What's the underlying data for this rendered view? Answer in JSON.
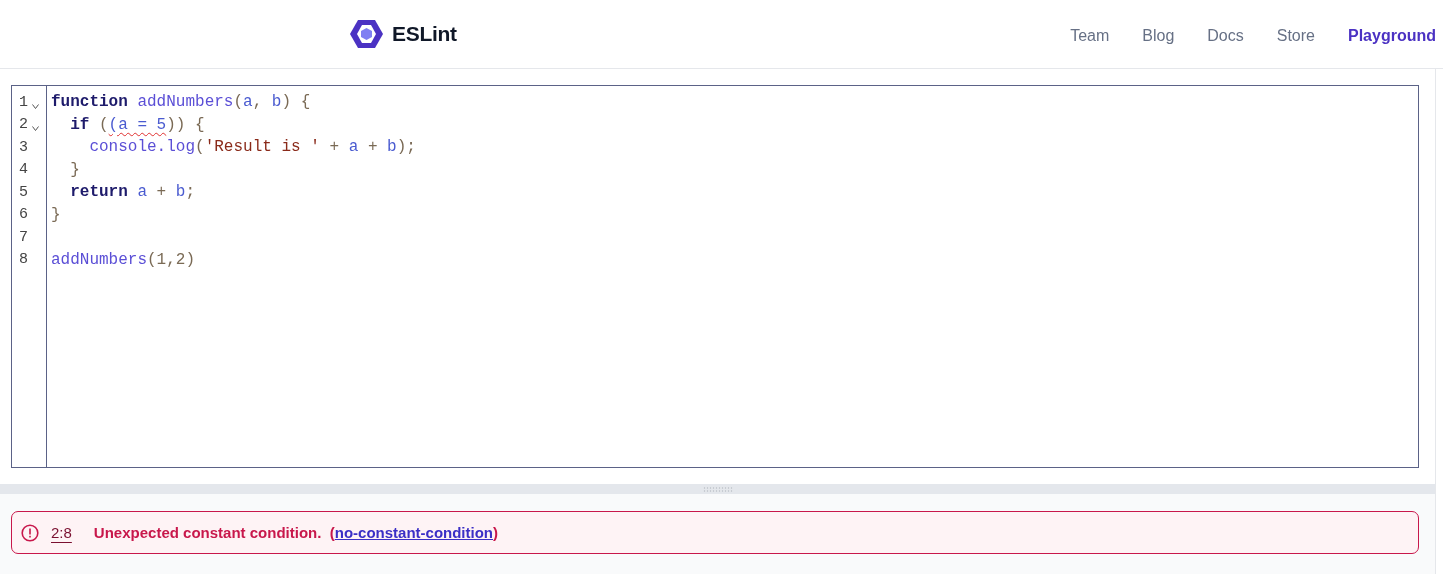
{
  "header": {
    "logo_text": "ESLint",
    "nav": [
      {
        "label": "Team",
        "selected": false
      },
      {
        "label": "Blog",
        "selected": false
      },
      {
        "label": "Docs",
        "selected": false
      },
      {
        "label": "Store",
        "selected": false
      },
      {
        "label": "Playground",
        "selected": true
      }
    ]
  },
  "editor": {
    "lines": [
      {
        "number": "1",
        "foldable": true,
        "tokens": [
          {
            "text": "function",
            "kind": "keyword"
          },
          {
            "text": " addNumbers",
            "kind": "name"
          },
          {
            "text": "(",
            "kind": "punct"
          },
          {
            "text": "a",
            "kind": "var"
          },
          {
            "text": ", ",
            "kind": "punct"
          },
          {
            "text": "b",
            "kind": "var"
          },
          {
            "text": ") {",
            "kind": "punct"
          }
        ]
      },
      {
        "number": "2",
        "foldable": true,
        "tokens": [
          {
            "text": "  if",
            "kind": "keyword"
          },
          {
            "text": " (",
            "kind": "punct"
          },
          {
            "text": "(a = 5",
            "kind": "var",
            "error": true
          },
          {
            "text": ")) {",
            "kind": "punct"
          }
        ]
      },
      {
        "number": "3",
        "foldable": false,
        "tokens": [
          {
            "text": "    console.log",
            "kind": "name"
          },
          {
            "text": "(",
            "kind": "punct"
          },
          {
            "text": "'Result is '",
            "kind": "string"
          },
          {
            "text": " + ",
            "kind": "punct"
          },
          {
            "text": "a",
            "kind": "var"
          },
          {
            "text": " + ",
            "kind": "punct"
          },
          {
            "text": "b",
            "kind": "var"
          },
          {
            "text": ");",
            "kind": "punct"
          }
        ]
      },
      {
        "number": "4",
        "foldable": false,
        "tokens": [
          {
            "text": "  }",
            "kind": "punct"
          }
        ]
      },
      {
        "number": "5",
        "foldable": false,
        "tokens": [
          {
            "text": "  return",
            "kind": "keyword"
          },
          {
            "text": " a",
            "kind": "var"
          },
          {
            "text": " + ",
            "kind": "punct"
          },
          {
            "text": "b",
            "kind": "var"
          },
          {
            "text": ";",
            "kind": "punct"
          }
        ]
      },
      {
        "number": "6",
        "foldable": false,
        "tokens": [
          {
            "text": "}",
            "kind": "punct"
          }
        ]
      },
      {
        "number": "7",
        "foldable": false
      },
      {
        "number": "8",
        "foldable": false,
        "tokens": [
          {
            "text": "addNumbers",
            "kind": "name"
          },
          {
            "text": "(1,2)",
            "kind": "punct"
          }
        ]
      }
    ]
  },
  "messages": [
    {
      "location": "2:8",
      "text": "Unexpected constant condition.",
      "before_rule": "(",
      "rule": "no-constant-condition",
      "after_rule": ")"
    }
  ]
}
